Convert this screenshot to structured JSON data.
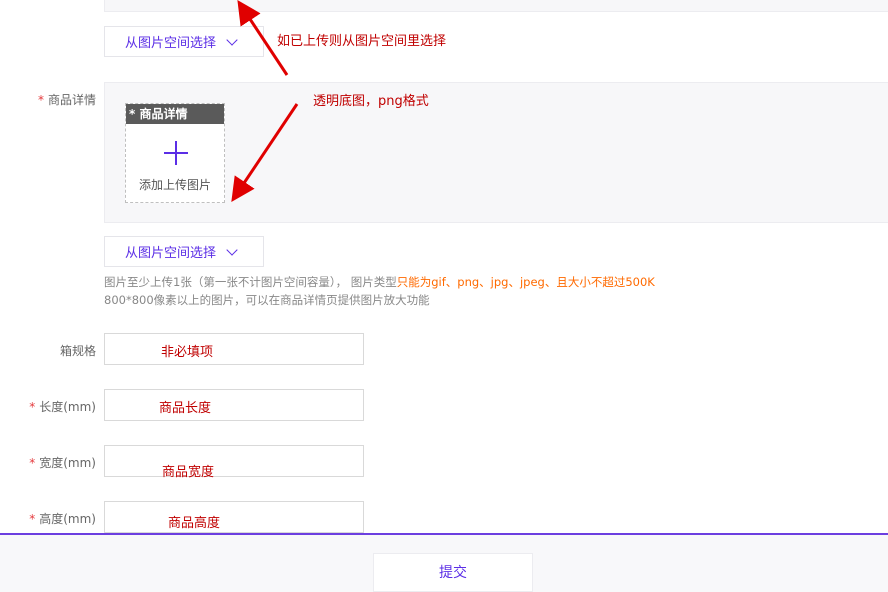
{
  "image_space_button": {
    "label": "从图片空间选择"
  },
  "annotations": {
    "top": "如已上传则从图片空间里选择",
    "detail": "透明底图，png格式"
  },
  "detail_field": {
    "label": "商品详情",
    "upload_tag": "* 商品详情",
    "upload_text": "添加上传图片"
  },
  "hint": {
    "line1_prefix": "图片至少上传1张（第一张不计图片空间容量），  图片类型",
    "line1_highlight": "只能为gif、png、jpg、jpeg、且大小不超过500K",
    "line2": "800*800像素以上的图片，可以在商品详情页提供图片放大功能"
  },
  "fields": [
    {
      "label": "箱规格",
      "required": false,
      "value": "非必填项"
    },
    {
      "label": "长度(mm)",
      "required": true,
      "value": "商品长度"
    },
    {
      "label": "宽度(mm)",
      "required": true,
      "value": "商品宽度"
    },
    {
      "label": "高度(mm)",
      "required": true,
      "value": "商品高度"
    }
  ],
  "submit": {
    "label": "提交"
  },
  "colors": {
    "accent": "#5b2ee6",
    "annotation": "#c00000",
    "required": "#e4393c",
    "hint_highlight": "#ff6a00"
  }
}
